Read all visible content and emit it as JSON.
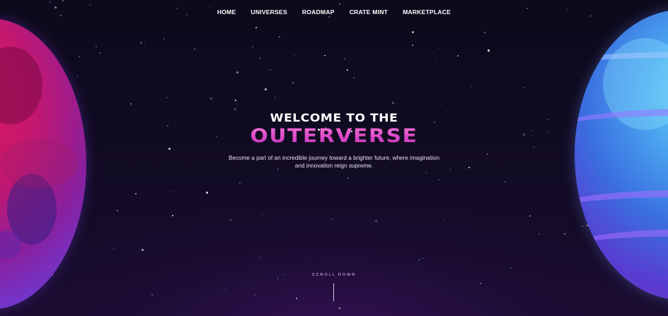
{
  "nav": {
    "items": [
      {
        "label": "HOME"
      },
      {
        "label": "UNIVERSES"
      },
      {
        "label": "ROADMAP"
      },
      {
        "label": "CRATE MINT"
      },
      {
        "label": "MARKETPLACE"
      }
    ]
  },
  "hero": {
    "heading_line1": "WELCOME TO THE",
    "heading_line2": "OUTERVERSE",
    "subtitle": "Become a part of an incredible journey toward a brighter future, where imagination and innovation reign supreme."
  },
  "scroll": {
    "label": "SCROLL DOWN"
  },
  "colors": {
    "background": "#0e0a1c",
    "accent_pink": "#e34fcf",
    "text": "#ffffff"
  }
}
